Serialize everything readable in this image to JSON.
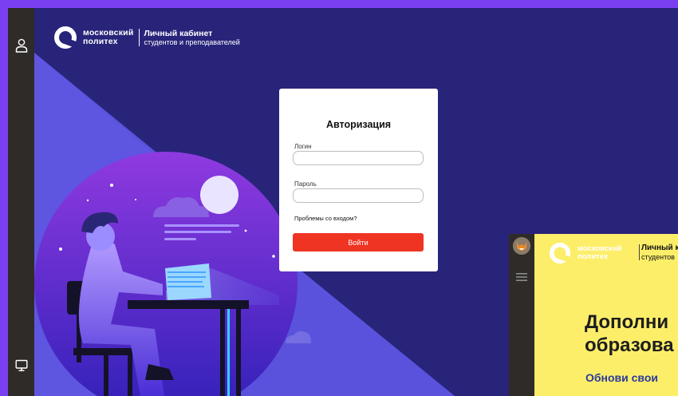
{
  "brand": {
    "university_line1": "московский",
    "university_line2": "политех",
    "cabinet_title": "Личный кабинет",
    "cabinet_subtitle": "студентов и преподавателей"
  },
  "sidebar": {
    "top_icon": "user-icon",
    "bottom_icon": "monitor-icon"
  },
  "login": {
    "title": "Авторизация",
    "login_label": "Логин",
    "login_value": "",
    "password_label": "Пароль",
    "password_value": "",
    "problems_link": "Проблемы со входом?",
    "submit_label": "Войти"
  },
  "preview": {
    "university_line1": "московский",
    "university_line2": "политех",
    "cabinet_title": "Личный к",
    "cabinet_subtitle": "студентов",
    "headline_line1": "Дополни",
    "headline_line2": "образова",
    "subline": "Обнови свои"
  },
  "colors": {
    "outer_frame": "#7b3ff2",
    "background": "#28247a",
    "submit_button": "#ef3424",
    "preview_background": "#fdee6a"
  }
}
